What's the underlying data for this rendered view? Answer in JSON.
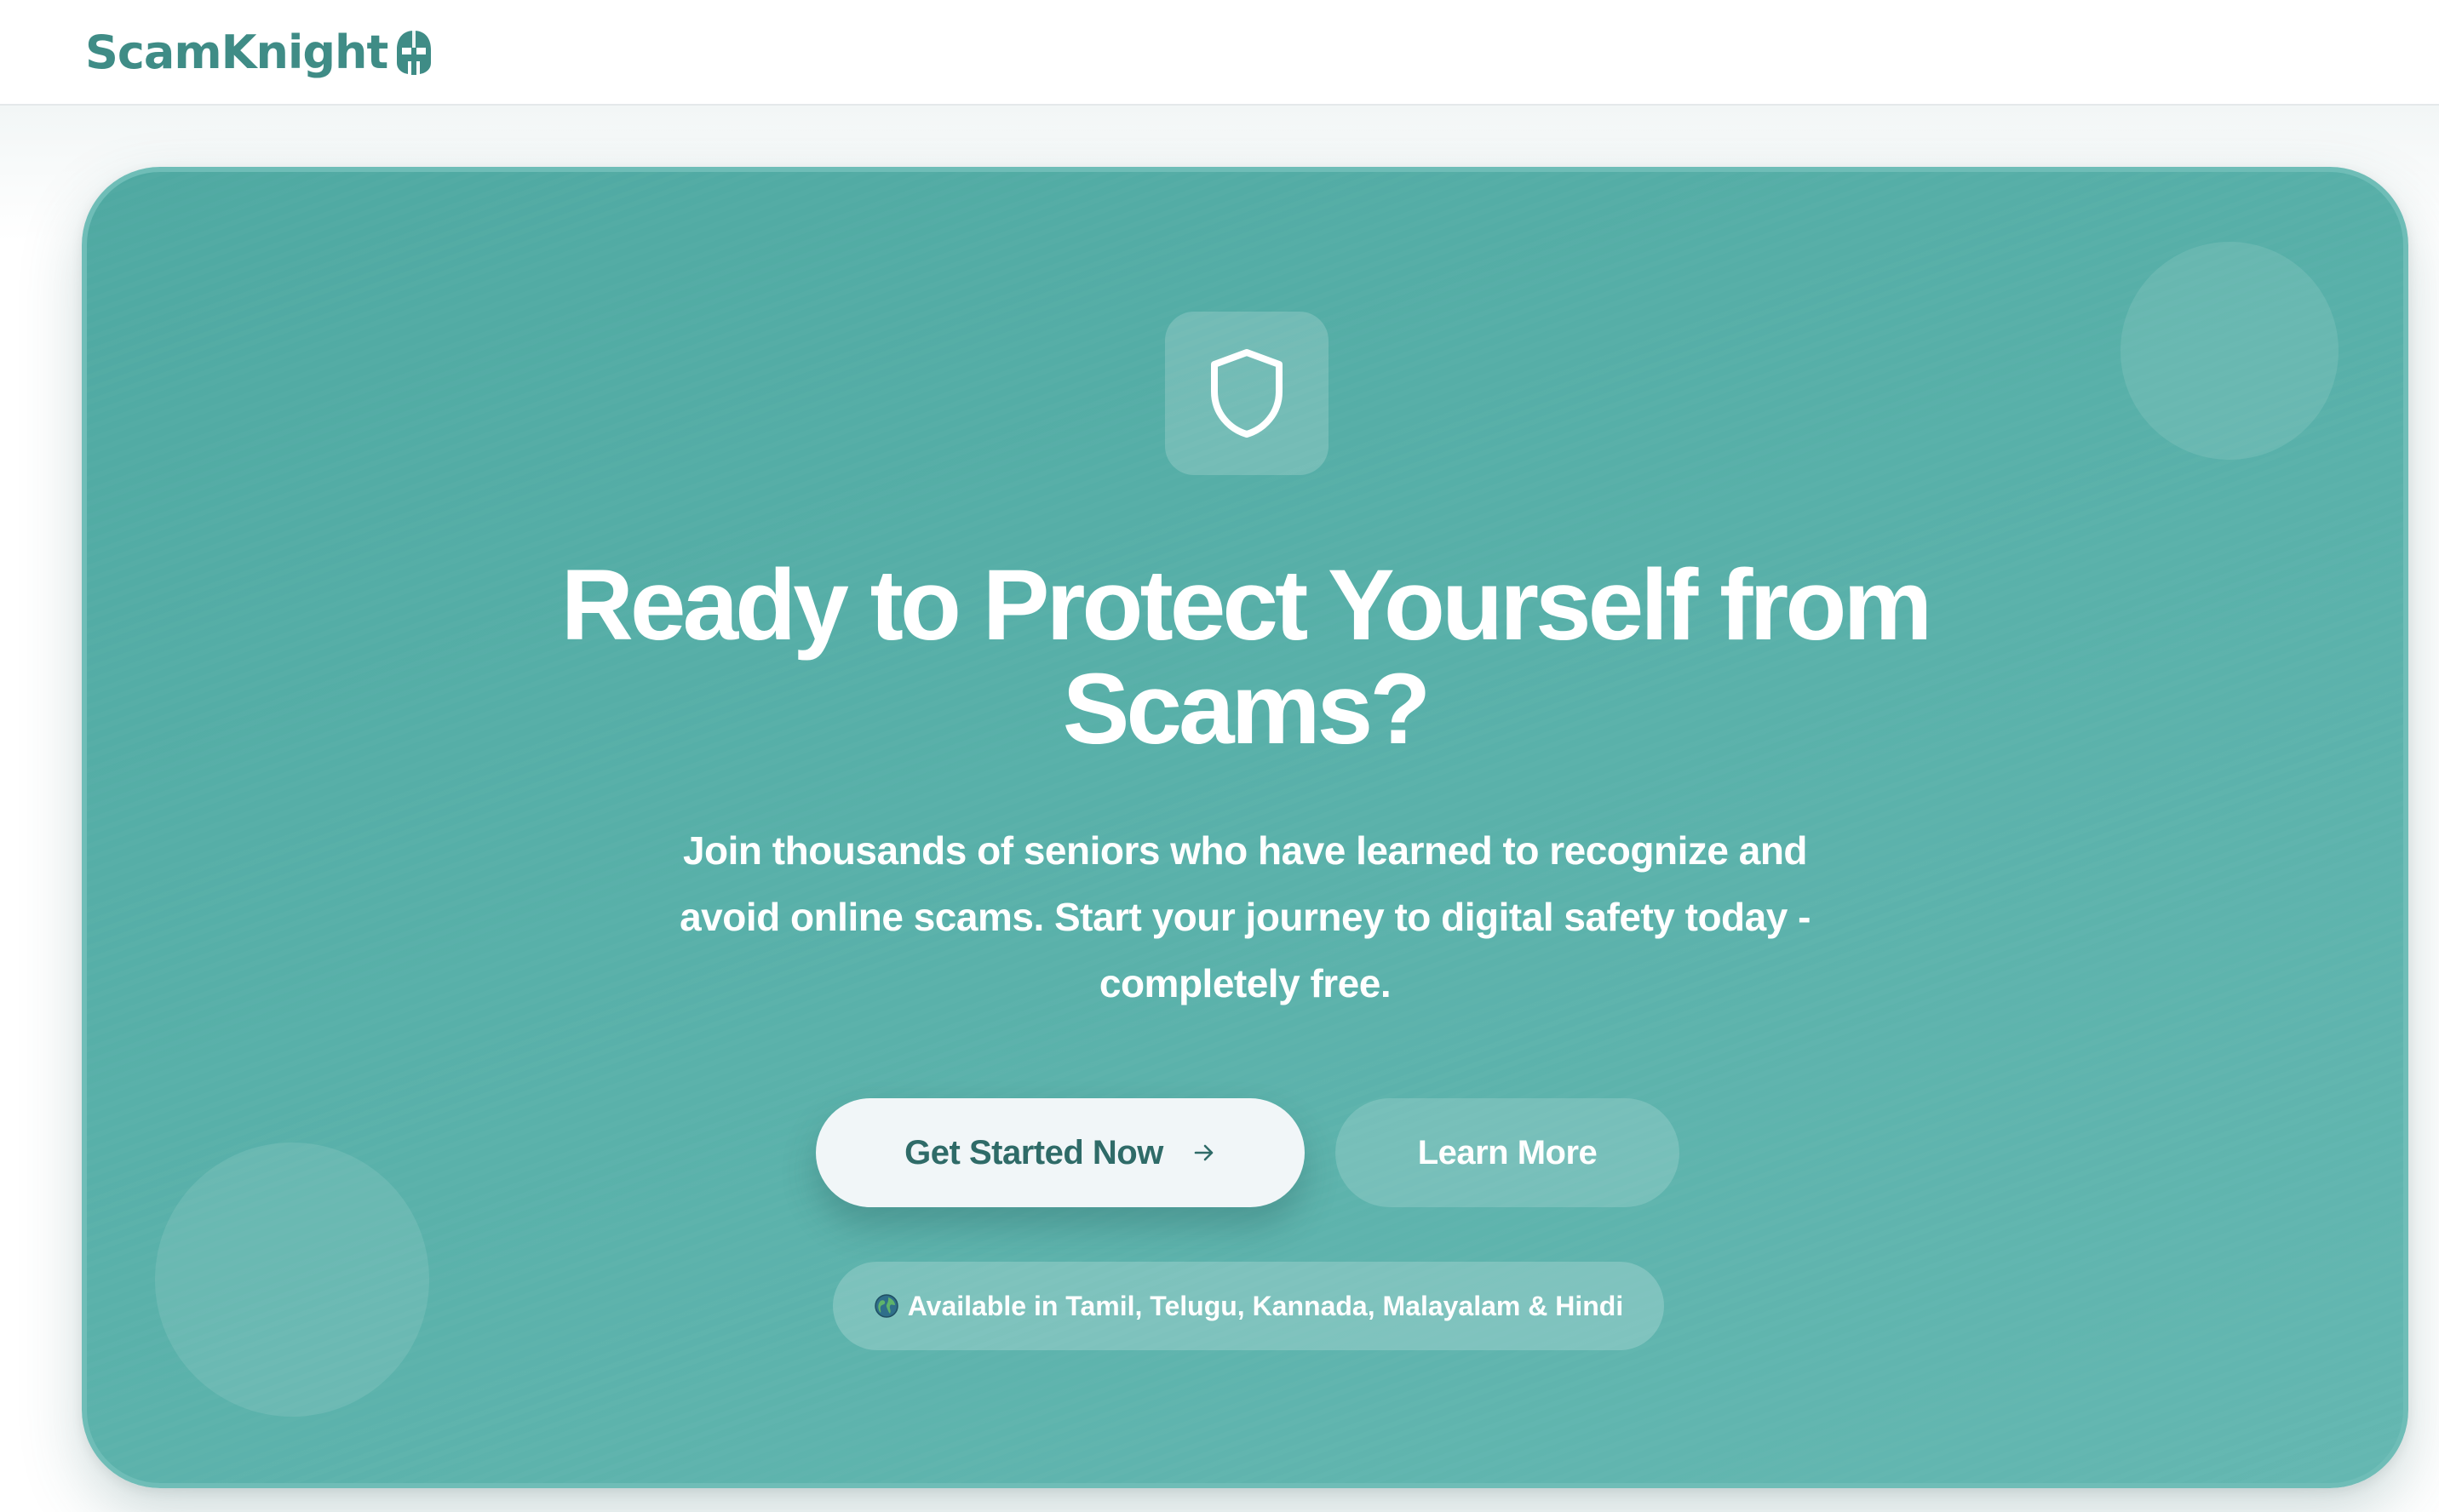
{
  "header": {
    "brand_name": "ScamKnight",
    "brand_icon": "knight-helmet-icon"
  },
  "hero": {
    "icon": "shield-icon",
    "title_line1": "Ready to Protect Yourself from",
    "title_line2": "Scams?",
    "subtitle": "Join thousands of seniors who have learned to recognize and avoid online scams. Start your journey to digital safety today - completely free.",
    "primary_button": {
      "label": "Get Started Now",
      "icon": "arrow-right-icon"
    },
    "secondary_button": {
      "label": "Learn More"
    },
    "languages": {
      "icon": "globe-icon",
      "text": "Available in Tamil, Telugu, Kannada, Malayalam & Hindi"
    }
  },
  "colors": {
    "brand": "#3f8c86",
    "hero_background": "#58b0a9",
    "primary_button_bg": "#f1f6f8",
    "primary_button_text": "#2f6b68",
    "text_on_hero": "#ffffff"
  }
}
